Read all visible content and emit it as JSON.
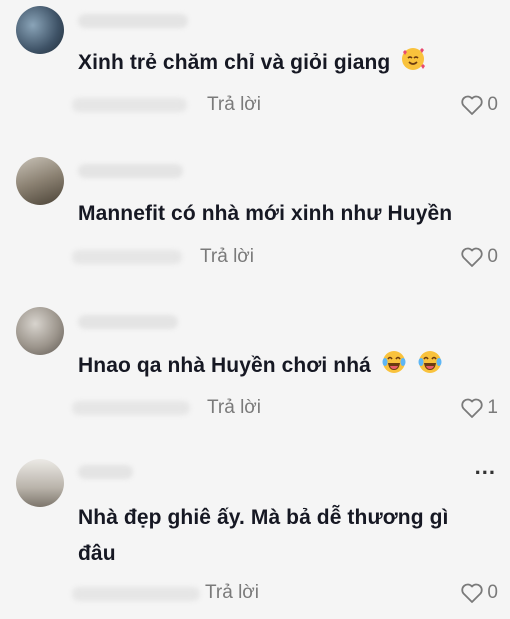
{
  "comments": [
    {
      "text": "Xinh trẻ chăm chỉ và giỏi giang",
      "emoji": "smiling-face-with-hearts",
      "reply_label": "Trả lời",
      "like_count": "0"
    },
    {
      "text": "Mannefit có nhà mới xinh như Huyền",
      "reply_label": "Trả lời",
      "like_count": "0"
    },
    {
      "text": "Hnao qa nhà Huyền chơi nhá",
      "emoji": "laughing-with-tears",
      "reply_label": "Trả lời",
      "like_count": "1"
    },
    {
      "text_line1": "Nhà đẹp ghiê ấy. Mà bả dễ thương gì",
      "text_line2": "đâu",
      "reply_label": "Trả lời",
      "like_count": "0",
      "more_label": "..."
    }
  ],
  "colors": {
    "background": "#f5f5f5",
    "text": "#161823",
    "secondary": "#7a7a7a"
  }
}
